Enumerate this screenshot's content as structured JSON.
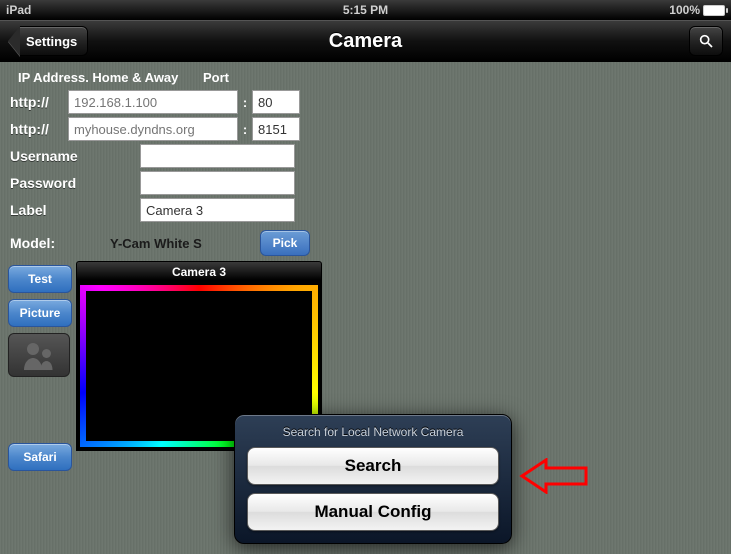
{
  "status": {
    "device": "iPad",
    "time": "5:15 PM",
    "battery": "100%"
  },
  "nav": {
    "back": "Settings",
    "title": "Camera"
  },
  "form": {
    "header_ip": "IP Address. Home & Away",
    "header_port": "Port",
    "proto": "http://",
    "home_ip_placeholder": "192.168.1.100",
    "home_port": "80",
    "away_ip_placeholder": "myhouse.dyndns.org",
    "away_port": "8151",
    "username_label": "Username",
    "username_value": "",
    "password_label": "Password",
    "password_value": "",
    "label_label": "Label",
    "label_value": "Camera 3",
    "model_label": "Model:",
    "model_value": "Y-Cam White S",
    "pick_label": "Pick"
  },
  "side": {
    "test": "Test",
    "picture": "Picture",
    "safari": "Safari"
  },
  "preview": {
    "title": "Camera 3"
  },
  "popover": {
    "title": "Search for Local Network Camera",
    "search": "Search",
    "manual": "Manual Config"
  }
}
